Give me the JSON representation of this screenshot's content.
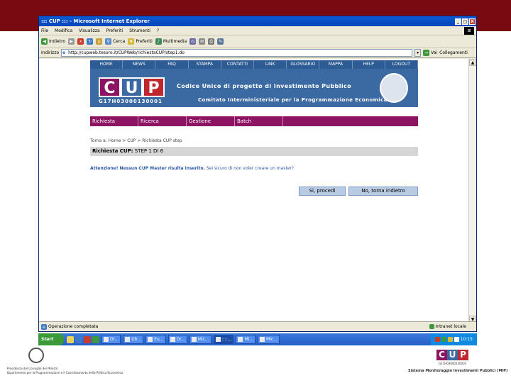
{
  "window": {
    "title": "::: CUP ::: - Microsoft Internet Explorer",
    "minimize": "_",
    "maximize": "□",
    "close": "X"
  },
  "menubar": [
    "File",
    "Modifica",
    "Visualizza",
    "Preferiti",
    "Strumenti",
    "?"
  ],
  "toolbar": {
    "back_label": "Indietro",
    "forward_label": "→",
    "search_label": "Cerca",
    "favorites_label": "Preferiti",
    "media_label": "Multimedia"
  },
  "address": {
    "label": "Indirizzo",
    "value": "http://cupweb.tesoro.it/CUPWeb/richiestaCUP/step1.do",
    "go_label": "Vai",
    "links_label": "Collegamenti"
  },
  "page": {
    "nav": [
      "HOME",
      "NEWS",
      "FAQ",
      "STAMPA",
      "CONTATTI",
      "LINK",
      "GLOSSARIO",
      "MAPPA",
      "HELP",
      "LOGOUT"
    ],
    "logo_letters": [
      "C",
      "U",
      "P"
    ],
    "code": "G17H03000130001",
    "banner_title": "Codice Unico di progetto di Investimento Pubblico",
    "banner_subtitle": "Comitato Interministeriale per la Programmazione Economica",
    "menu": [
      "Richiesta",
      "Ricerca",
      "Gestione",
      "Batch"
    ],
    "breadcrumb": "Torna a: Home > CUP > Richiesta CUP step",
    "step_label": "Richiesta CUP:",
    "step_value": "STEP 1 DI 6",
    "warning_bold": "Attenzione! Nessun CUP Master risulta inserito.",
    "warning_rest": " Sei sicuro di non voler creare un master?",
    "btn_proceed": "Si, procedi",
    "btn_back": "No, torna indietro"
  },
  "statusbar": {
    "text": "Operazione completata",
    "zone": "Intranet locale"
  },
  "taskbar": {
    "start": "Start",
    "tasks": [
      "Dr...",
      "Ub...",
      "Eu...",
      "Dr...",
      "Mic...",
      "::::...",
      "Mi...",
      "Mic..."
    ],
    "clock": "10:15"
  },
  "footer": {
    "left_text_1": "Presidenza del Consiglio dei Ministri",
    "left_text_2": "Dipartimento per la Programmazione e il Coordinamento della Politica Economica",
    "logo_letters": [
      "C",
      "U",
      "P"
    ],
    "code": "G17H03000130001",
    "caption": "Sistema Monitoraggio Investimenti Pubblici (MIP)"
  },
  "colors": {
    "band": "#7a0a12",
    "nav": "#2d5b93",
    "banner": "#3b6aa3",
    "menu": "#8c1463",
    "logo_c": "#8c1463",
    "logo_p": "#c0282d"
  },
  "icons": [
    "back-icon",
    "forward-icon",
    "stop-icon",
    "refresh-icon",
    "home-icon",
    "search-icon",
    "favorites-icon",
    "media-icon",
    "history-icon",
    "mail-icon",
    "print-icon",
    "edit-icon"
  ]
}
